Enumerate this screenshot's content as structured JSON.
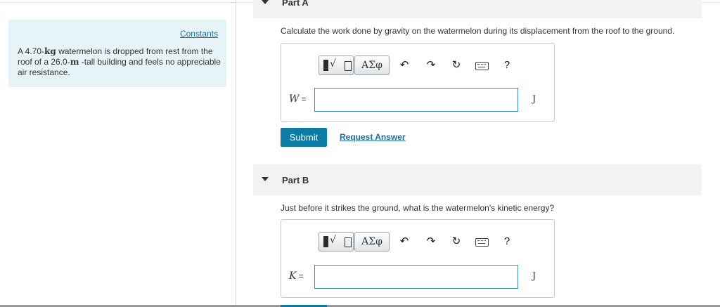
{
  "sidebar": {
    "constants_label": "Constants",
    "problem": {
      "p1": "A 4.70-",
      "unit1": "kg",
      "p2": " watermelon is dropped from rest from the roof of a 26.0-",
      "unit2": "m",
      "p3": " -tall building and feels no appreciable air resistance."
    }
  },
  "part_a": {
    "title": "Part A",
    "question": "Calculate the work done by gravity on the watermelon during its displacement from the roof to the ground.",
    "var": "W",
    "eq": " =",
    "unit": "J",
    "value": "",
    "submit_label": "Submit",
    "request_label": "Request Answer"
  },
  "part_b": {
    "title": "Part B",
    "question": "Just before it strikes the ground, what is the watermelon's kinetic energy?",
    "var": "K",
    "eq": " =",
    "unit": "J",
    "value": ""
  },
  "toolbar": {
    "templates_radical": "√",
    "greek_label": "ΑΣφ",
    "undo_symbol": "↶",
    "redo_symbol": "↷",
    "reset_symbol": "↻",
    "help_symbol": "?",
    "icons": [
      "templates-icon",
      "greek-symbols-icon",
      "undo-icon",
      "redo-icon",
      "reset-icon",
      "keyboard-icon",
      "help-icon"
    ]
  },
  "colors": {
    "accent": "#0d7ca4",
    "link": "#1a6fa3",
    "info_bg": "#e6f4f7",
    "header_bg": "#f2f2f2"
  }
}
